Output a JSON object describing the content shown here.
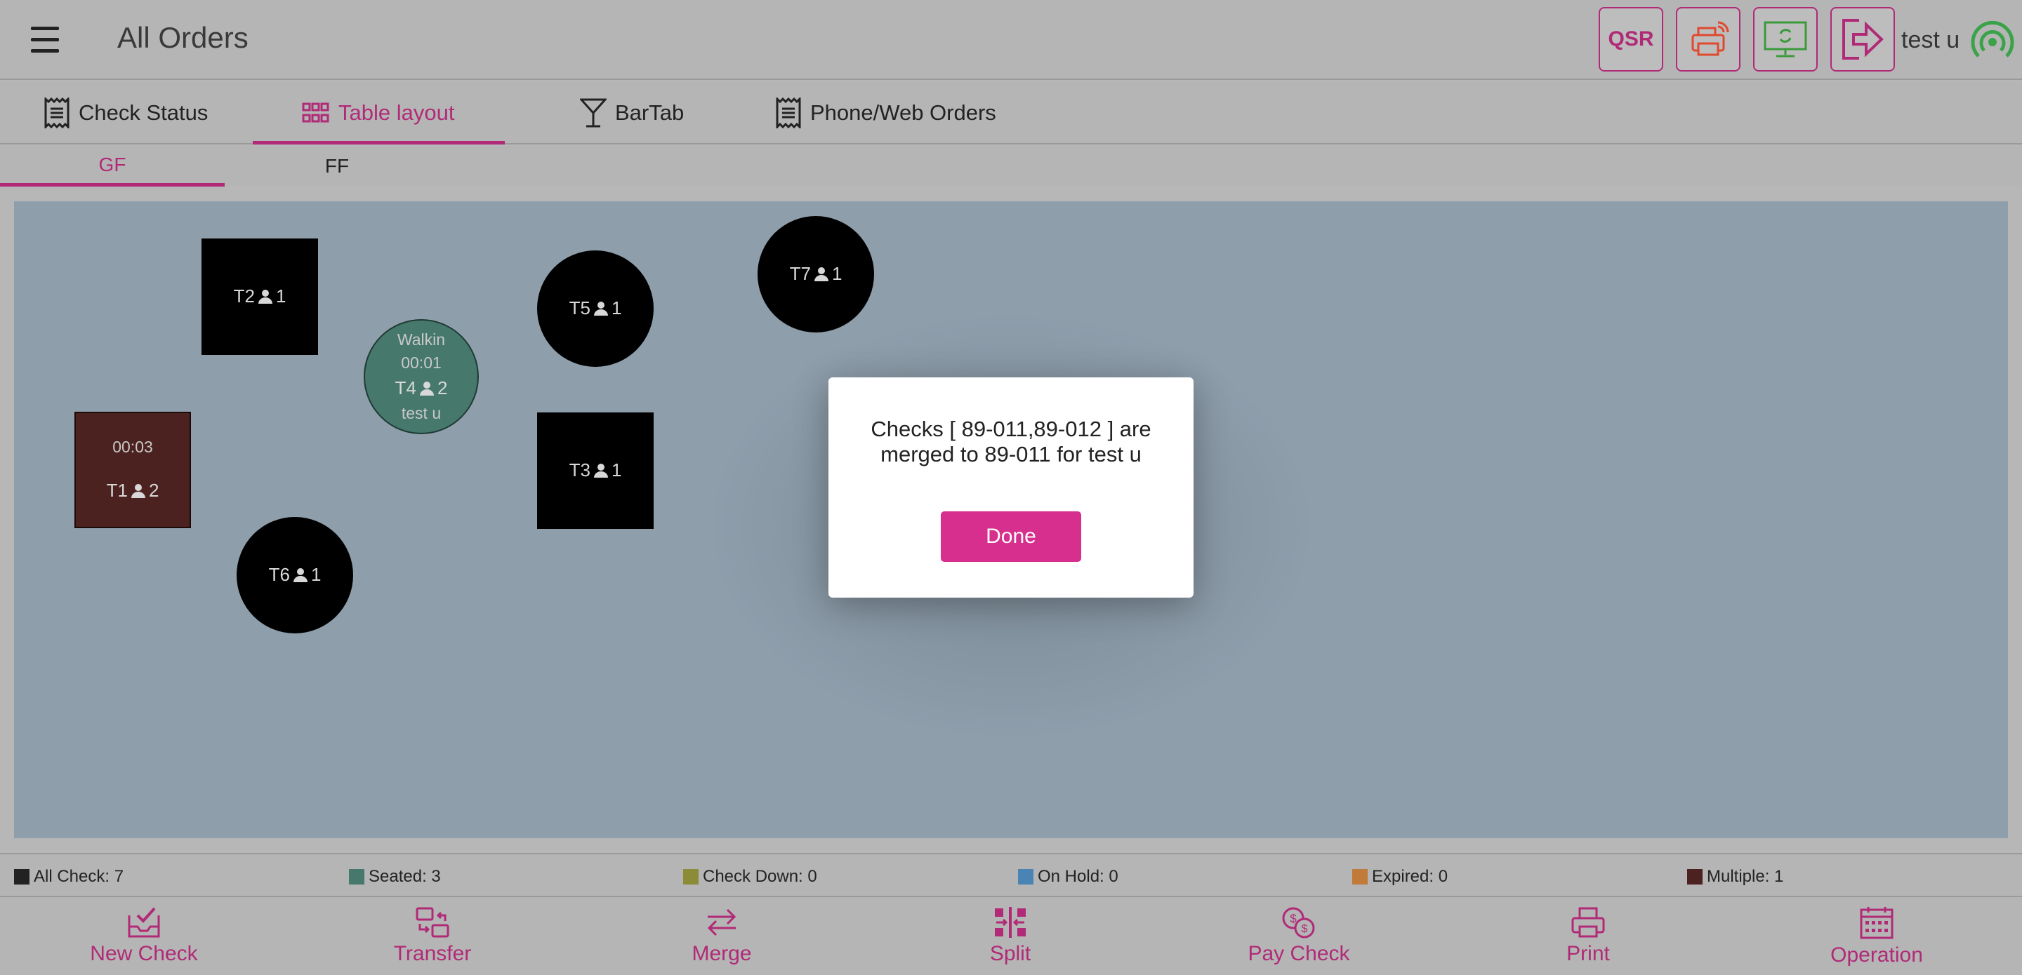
{
  "header": {
    "title": "All Orders",
    "qsr_label": "QSR",
    "user": "test u"
  },
  "tabs": [
    {
      "label": "Check Status",
      "icon": "receipt-icon"
    },
    {
      "label": "Table layout",
      "icon": "grid-icon"
    },
    {
      "label": "BarTab",
      "icon": "cocktail-icon"
    },
    {
      "label": "Phone/Web Orders",
      "icon": "receipt-icon"
    }
  ],
  "active_tab": "Table layout",
  "floors": [
    {
      "label": "GF"
    },
    {
      "label": "FF"
    }
  ],
  "active_floor": "GF",
  "tables": {
    "t1": {
      "time": "00:03",
      "name": "T1",
      "guests": "2"
    },
    "t2": {
      "name": "T2",
      "guests": "1"
    },
    "t3": {
      "name": "T3",
      "guests": "1"
    },
    "t4": {
      "type": "Walkin",
      "time": "00:01",
      "name": "T4",
      "guests": "2",
      "server": "test u"
    },
    "t5": {
      "name": "T5",
      "guests": "1"
    },
    "t6": {
      "name": "T6",
      "guests": "1"
    },
    "t7": {
      "name": "T7",
      "guests": "1"
    }
  },
  "modal": {
    "message": "Checks [ 89-011,89-012 ] are merged to 89-011 for test u",
    "done_label": "Done"
  },
  "legend": [
    {
      "label": "All Check: 7",
      "color": "#222222"
    },
    {
      "label": "Seated: 3",
      "color": "#46786c"
    },
    {
      "label": "Check Down: 0",
      "color": "#8c8c38"
    },
    {
      "label": "On Hold: 0",
      "color": "#4a84b4"
    },
    {
      "label": "Expired: 0",
      "color": "#c07a3a"
    },
    {
      "label": "Multiple: 1",
      "color": "#4c2220"
    }
  ],
  "toolbar": [
    {
      "label": "New Check",
      "icon": "new-check-icon"
    },
    {
      "label": "Transfer",
      "icon": "transfer-icon"
    },
    {
      "label": "Merge",
      "icon": "merge-icon"
    },
    {
      "label": "Split",
      "icon": "split-icon"
    },
    {
      "label": "Pay Check",
      "icon": "pay-check-icon"
    },
    {
      "label": "Print",
      "icon": "print-icon"
    },
    {
      "label": "Operation",
      "icon": "calendar-icon"
    }
  ],
  "colors": {
    "accent": "#b12a77",
    "button": "#d62f8d",
    "floor": "#8e9eab"
  }
}
